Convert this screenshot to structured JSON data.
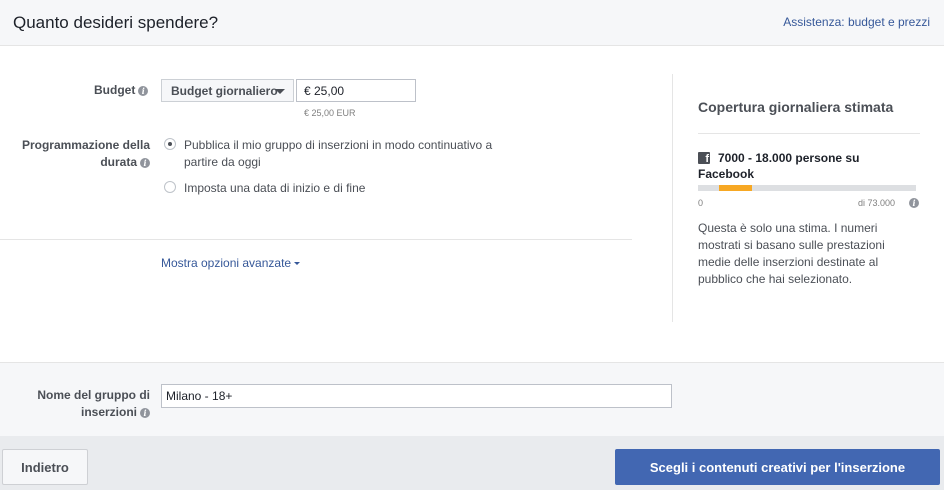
{
  "header": {
    "title": "Quanto desideri spendere?",
    "help_link": "Assistenza: budget e prezzi"
  },
  "budget": {
    "label": "Budget",
    "type_selected": "Budget giornaliero",
    "amount": "€ 25,00",
    "amount_sub": "€ 25,00 EUR"
  },
  "schedule": {
    "label_line1": "Programmazione della",
    "label_line2": "durata",
    "options": [
      {
        "label": "Pubblica il mio gruppo di inserzioni in modo continuativo a partire da oggi",
        "checked": true
      },
      {
        "label": "Imposta una data di inizio e di fine",
        "checked": false
      }
    ]
  },
  "advanced": {
    "link": "Mostra opzioni avanzate"
  },
  "reach": {
    "title": "Copertura giornaliera stimata",
    "estimate": "7000 - 18.000 persone su Facebook",
    "scale_min": "0",
    "scale_max": "di 73.000",
    "range_low": 7000,
    "range_high": 18000,
    "range_total": 73000,
    "bar_color": "#f7a823",
    "note": "Questa è solo una stima. I numeri mostrati si basano sulle prestazioni medie delle inserzioni destinate al pubblico che hai selezionato."
  },
  "adset_name": {
    "label_line1": "Nome del gruppo di",
    "label_line2": "inserzioni",
    "value": "Milano - 18+"
  },
  "footer": {
    "back_label": "Indietro",
    "next_label": "Scegli i contenuti creativi per l'inserzione"
  },
  "colors": {
    "link": "#365899",
    "primary_button": "#4267b2"
  }
}
